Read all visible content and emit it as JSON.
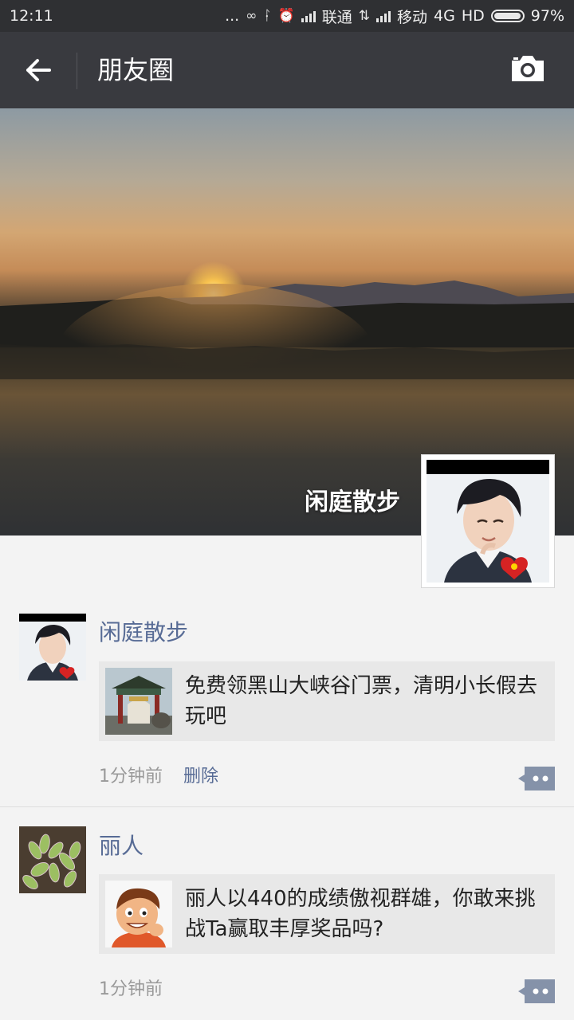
{
  "status_bar": {
    "time": "12:11",
    "dots": "...",
    "carrier1": "联通",
    "carrier2": "移动",
    "network": "4G",
    "hd": "HD",
    "battery": "97%",
    "battery_level": 0.97
  },
  "header": {
    "back_icon": "arrow-left-icon",
    "title": "朋友圈",
    "camera_icon": "camera-icon"
  },
  "cover": {
    "username": "闲庭散步"
  },
  "posts": [
    {
      "author": "闲庭散步",
      "link_text": "免费领黑山大峡谷门票，清明小长假去玩吧",
      "time": "1分钟前",
      "delete_label": "删除"
    },
    {
      "author": "丽人",
      "link_text": "丽人以440的成绩傲视群雄，你敢来挑战Ta赢取丰厚奖品吗?",
      "time": "1分钟前"
    }
  ],
  "colors": {
    "status_bar_bg": "#2f3033",
    "title_bar_bg": "#393a3f",
    "author_link": "#576b95",
    "card_bg": "#e8e8e8"
  }
}
